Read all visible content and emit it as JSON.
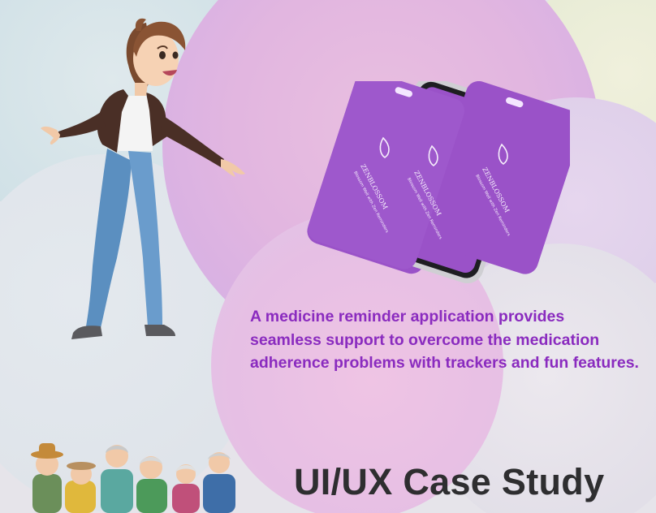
{
  "description": "A medicine reminder application provides seamless support to overcome the medication adherence problems with trackers and  fun features.",
  "title": "UI/UX Case Study",
  "phones": {
    "brand": "ZENBLOSSOM",
    "tagline": "Blossom Well with Zen Reminders"
  },
  "colors": {
    "accent_text": "#8a2bbf",
    "phone_purple": "#9a52c8",
    "title_text": "#2e2e30"
  }
}
